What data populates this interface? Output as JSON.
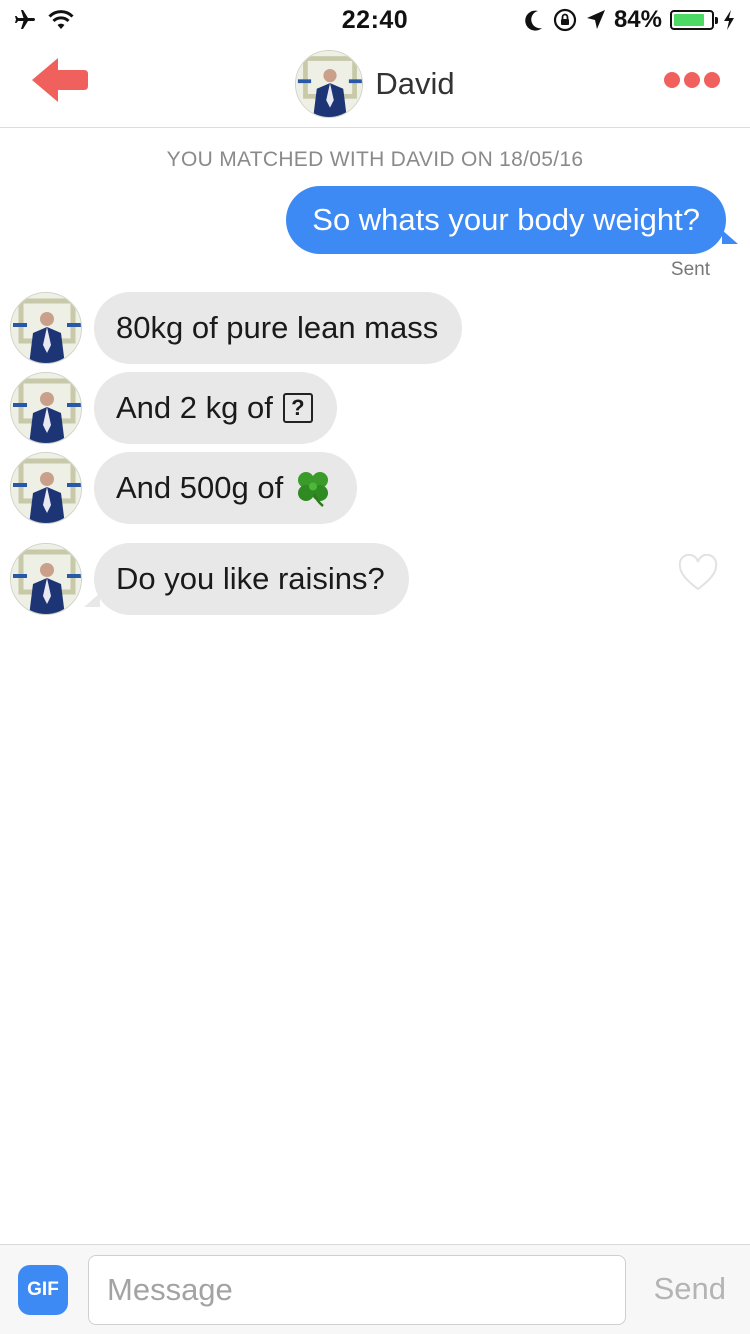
{
  "status_bar": {
    "time": "22:40",
    "battery_percent": "84%",
    "battery_level": 0.84,
    "icons": [
      "airplane-icon",
      "wifi-icon",
      "moon-icon",
      "rotation-lock-icon",
      "location-icon",
      "battery-icon",
      "charging-icon"
    ]
  },
  "header": {
    "name": "David",
    "back_icon": "back-arrow-icon",
    "more_icon": "more-dots-icon",
    "accent_color": "#f0605d"
  },
  "conversation": {
    "match_note": "YOU MATCHED WITH DAVID ON 18/05/16",
    "outgoing": [
      {
        "text": "So whats your body weight?",
        "status": "Sent"
      }
    ],
    "incoming": [
      {
        "text": "80kg of pure lean mass"
      },
      {
        "text": "And 2 kg of",
        "symbol": "?"
      },
      {
        "text": "And 500g of",
        "emoji": "four-leaf-clover-icon"
      },
      {
        "text": "Do you like raisins?"
      }
    ],
    "outgoing_color": "#3e8af4",
    "incoming_color": "#e8e8e8"
  },
  "composer": {
    "gif_label": "GIF",
    "placeholder": "Message",
    "send_label": "Send"
  }
}
